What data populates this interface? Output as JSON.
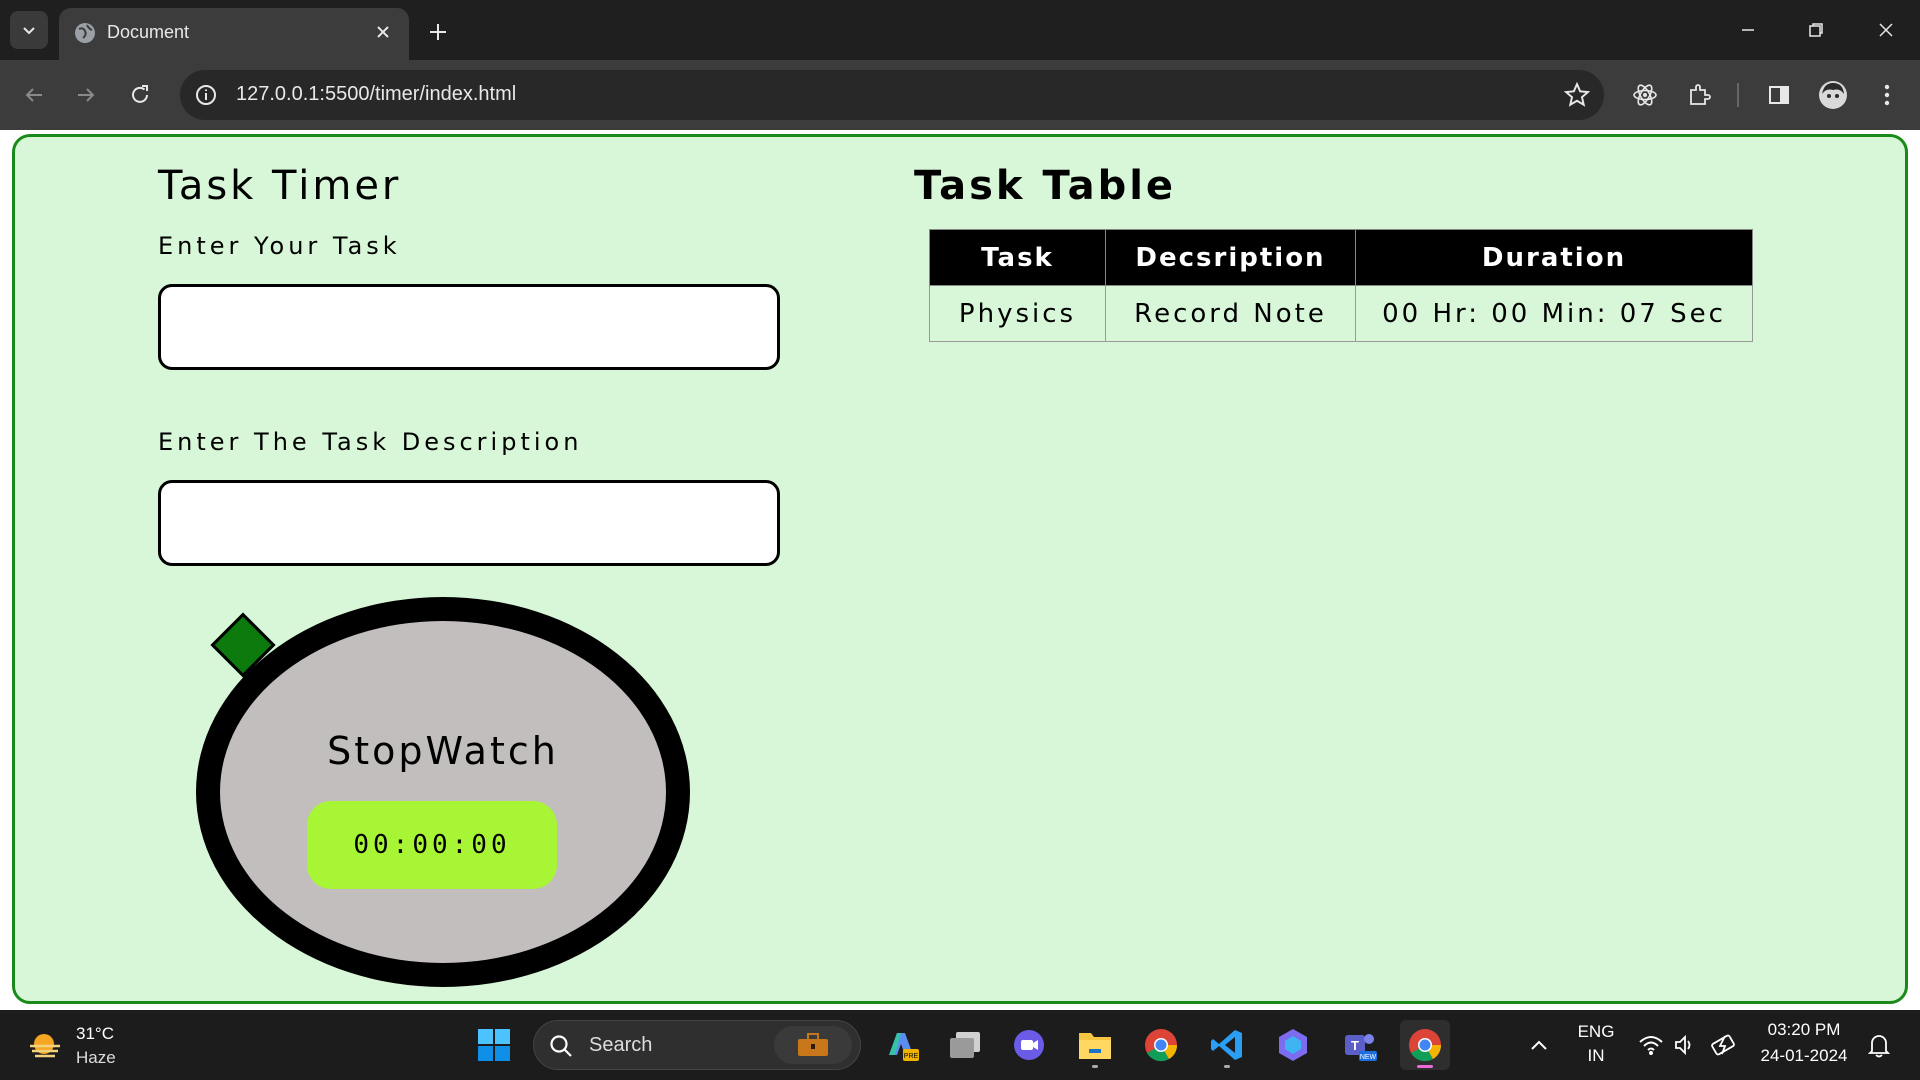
{
  "browser": {
    "tab_title": "Document",
    "url": "127.0.0.1:5500/timer/index.html"
  },
  "page": {
    "timer_heading": "Task Timer",
    "task_label": "Enter Your Task",
    "task_value": "",
    "description_label": "Enter The Task Description",
    "description_value": "",
    "stopwatch_title": "StopWatch",
    "stopwatch_display": "00:00:00",
    "table_heading": "Task Table",
    "table": {
      "columns": [
        "Task",
        "Decsription",
        "Duration"
      ],
      "rows": [
        [
          "Physics",
          "Record Note",
          "00 Hr: 00 Min: 07 Sec"
        ]
      ]
    },
    "colors": {
      "background": "#d8f7d8",
      "border": "#1a8a1a",
      "display": "#a8f536",
      "knob": "#0c7a0c",
      "stopwatch_face": "#c3bebe"
    }
  },
  "taskbar": {
    "weather_temp": "31°C",
    "weather_condition": "Haze",
    "search_label": "Search",
    "language_line1": "ENG",
    "language_line2": "IN",
    "time": "03:20 PM",
    "date": "24-01-2024",
    "apps": [
      "windows-start-icon",
      "copilot-icon",
      "task-view-icon",
      "video-chat-icon",
      "file-explorer-icon",
      "chrome-icon",
      "vscode-icon",
      "bing-icon",
      "teams-icon",
      "chrome-active-icon"
    ]
  }
}
